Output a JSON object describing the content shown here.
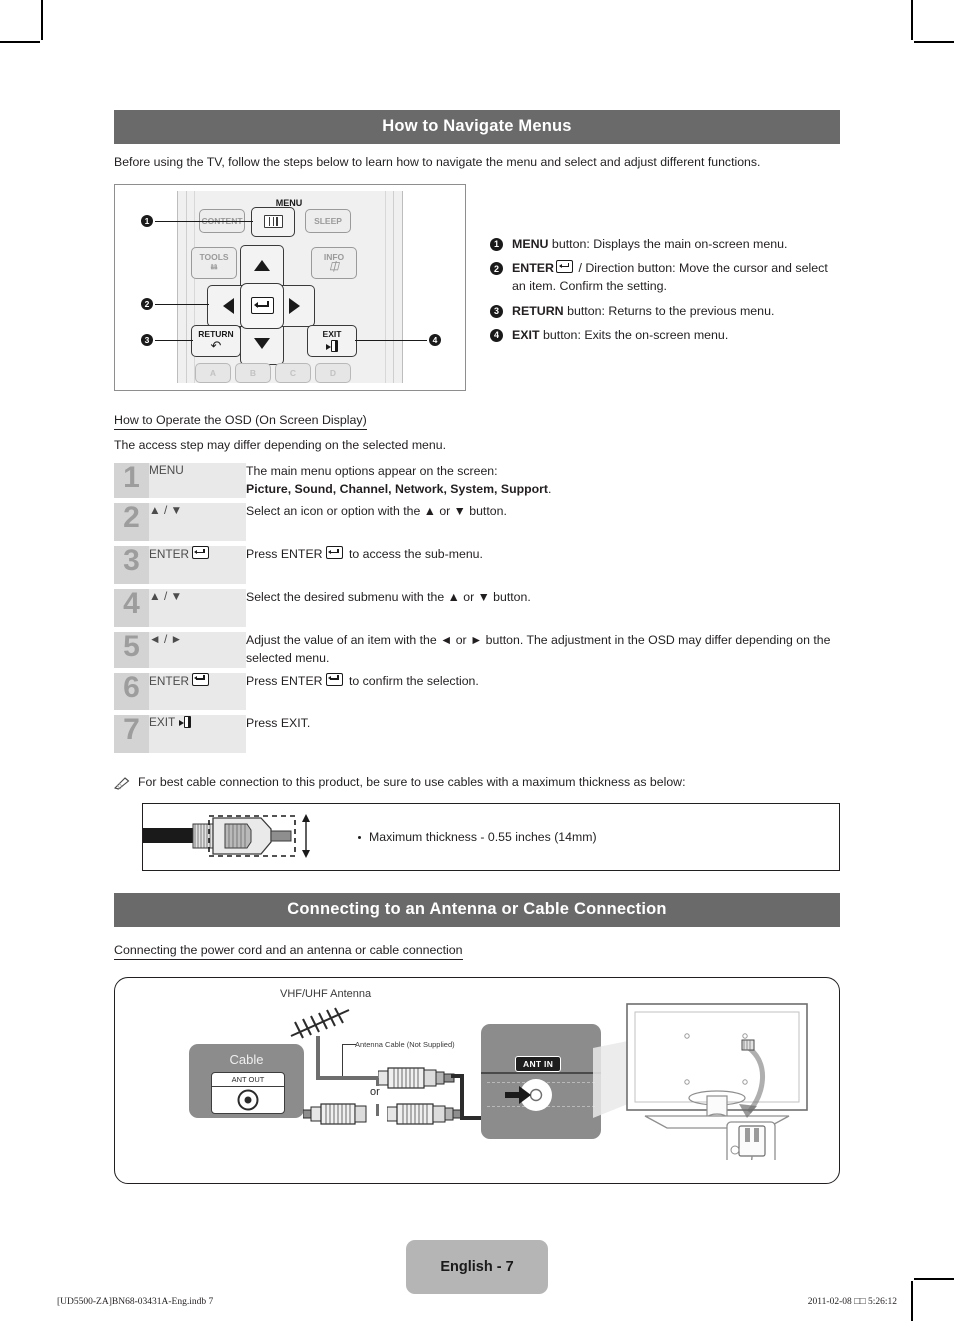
{
  "sections": {
    "navigate": {
      "title": "How to Navigate Menus",
      "intro": "Before using the TV, follow the steps below to learn how to navigate the menu and select and adjust different functions."
    },
    "antenna": {
      "title": "Connecting to an Antenna or Cable Connection",
      "subtitle": "Connecting the power cord and an antenna or cable connection"
    }
  },
  "remote": {
    "buttons": {
      "content": "CONTENT",
      "menu": "MENU",
      "sleep": "SLEEP",
      "tools": "TOOLS",
      "info": "INFO",
      "return": "RETURN",
      "exit": "EXIT",
      "color_a": "A",
      "color_b": "B",
      "color_c": "C",
      "color_d": "D"
    },
    "callouts": [
      "1",
      "2",
      "3",
      "4"
    ]
  },
  "legend": [
    {
      "num": "1",
      "label": "MENU",
      "text": " button: Displays the main on-screen menu."
    },
    {
      "num": "2",
      "label": "ENTER",
      "text": " / Direction button: Move the cursor and select an item. Confirm the setting."
    },
    {
      "num": "3",
      "label": "RETURN",
      "text": " button: Returns to the previous menu."
    },
    {
      "num": "4",
      "label": "EXIT",
      "text": " button: Exits the on-screen menu."
    }
  ],
  "osd": {
    "heading": "How to Operate the OSD (On Screen Display)",
    "note": "The access step may differ depending on the selected menu.",
    "steps": [
      {
        "num": "1",
        "key": "MENU",
        "key_glyph": "none",
        "desc_line1": "The main menu options appear on the screen:",
        "desc_bold": "Picture, Sound, Channel, Network, System, Support",
        "desc_tail": "."
      },
      {
        "num": "2",
        "key": "▲ / ▼",
        "key_glyph": "none",
        "desc_line1": "Select an icon or option with the ▲ or ▼ button.",
        "desc_bold": "",
        "desc_tail": ""
      },
      {
        "num": "3",
        "key": "ENTER",
        "key_glyph": "enter",
        "desc_pre": "Press ENTER",
        "desc_post": " to access the sub-menu.",
        "desc_glyph": "enter"
      },
      {
        "num": "4",
        "key": "▲ / ▼",
        "key_glyph": "none",
        "desc_line1": "Select the desired submenu with the ▲ or ▼ button.",
        "desc_bold": "",
        "desc_tail": ""
      },
      {
        "num": "5",
        "key": "◄ / ►",
        "key_glyph": "none",
        "desc_line1": "Adjust the value of an item with the ◄ or ► button. The adjustment in the OSD may differ depending on the selected menu.",
        "desc_bold": "",
        "desc_tail": ""
      },
      {
        "num": "6",
        "key": "ENTER",
        "key_glyph": "enter",
        "desc_pre": "Press ENTER",
        "desc_post": " to confirm the selection.",
        "desc_glyph": "enter"
      },
      {
        "num": "7",
        "key": "EXIT",
        "key_glyph": "exit",
        "desc_pre": "Press EXIT.",
        "desc_post": "",
        "desc_glyph": "none"
      }
    ]
  },
  "cable_note": {
    "text": "For best cable connection to this product, be sure to use cables with a maximum thickness as below:",
    "spec": "Maximum thickness - 0.55 inches (14mm)"
  },
  "antenna_diagram": {
    "vhf_label": "VHF/UHF Antenna",
    "antenna_cable_label": "Antenna Cable (Not Supplied)",
    "cable_box_label": "Cable",
    "ant_out_label": "ANT OUT",
    "ant_in_label": "ANT IN",
    "or_label": "or"
  },
  "footer": {
    "page_badge": "English - 7",
    "left": "[UD5500-ZA]BN68-03431A-Eng.indb   7",
    "right": "2011-02-08   □□ 5:26:12"
  },
  "colors": {
    "section_bar": "#6b6a6b",
    "step_num_bg": "#d3d3d3",
    "step_key_bg": "#e9e9e9",
    "badge_bg": "#b5b5b5",
    "panel_gray": "#8c8c8c"
  }
}
